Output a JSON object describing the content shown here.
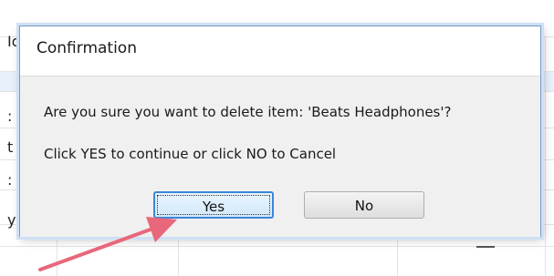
{
  "background_grid": {
    "row_fragments": [
      "Id",
      "",
      ":",
      "t",
      ":",
      "y"
    ]
  },
  "dialog": {
    "title": "Confirmation",
    "message": "Are you sure you want to delete item: 'Beats Headphones'?",
    "instruction": "Click YES to continue or click NO to Cancel",
    "yes_label": "Yes",
    "no_label": "No"
  },
  "annotation": {
    "arrow_color": "#e8677a"
  }
}
